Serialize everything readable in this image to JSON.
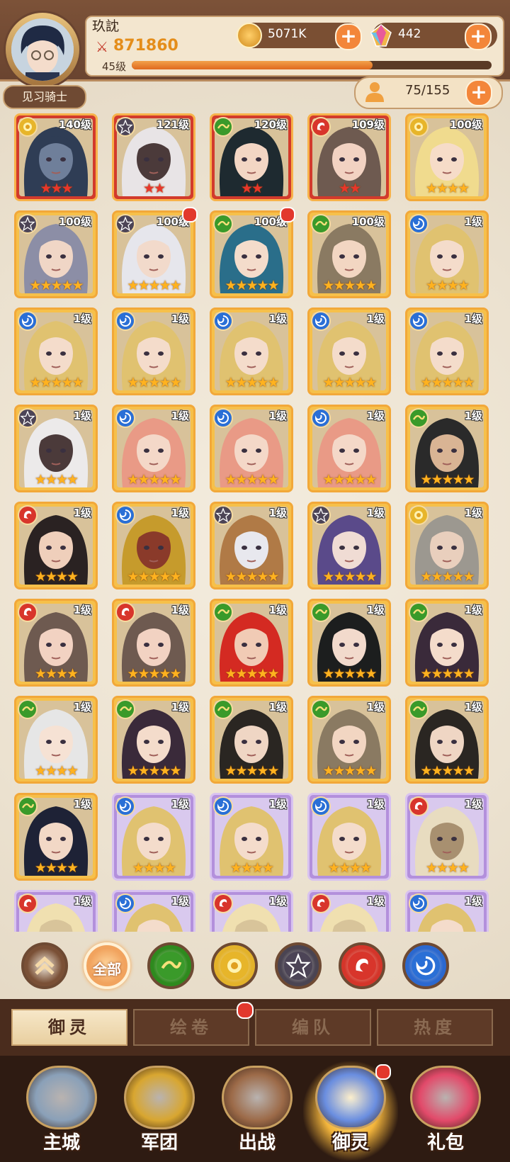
{
  "player": {
    "name": "玖訦",
    "power": "871860",
    "level_label": "45级",
    "level_progress": 0.67,
    "rank_title": "见习骑士"
  },
  "resources": {
    "coins": "5071K",
    "gems": "442",
    "hero_count": "75/155"
  },
  "plus_label": "+",
  "element_colors": {
    "gold": "#e7b52a",
    "dark": "#4c4456",
    "green": "#3a9a2a",
    "red": "#d8352b",
    "blue": "#2a6fd6"
  },
  "heroes": [
    {
      "level": "140级",
      "element": "gold",
      "stars": 3,
      "frame": "red",
      "hair": "#2f3d55",
      "skin": "#6f7f9a"
    },
    {
      "level": "121级",
      "element": "dark",
      "stars": 2,
      "frame": "red",
      "hair": "#e8e4e6",
      "skin": "#4b3a3a"
    },
    {
      "level": "120级",
      "element": "green",
      "stars": 2,
      "frame": "red",
      "hair": "#1e2a30",
      "skin": "#f3d6c4"
    },
    {
      "level": "109级",
      "element": "red",
      "stars": 2,
      "frame": "red",
      "hair": "#6e5a50",
      "skin": "#f2d2c2"
    },
    {
      "level": "100级",
      "element": "gold",
      "stars": 4,
      "frame": "gold",
      "hair": "#f0db8e",
      "skin": "#f6dcc8"
    },
    {
      "level": "100级",
      "element": "dark",
      "stars": 5,
      "frame": "gold",
      "hair": "#8c8ea6",
      "skin": "#f0d6c6"
    },
    {
      "level": "100级",
      "element": "dark",
      "stars": 5,
      "frame": "gold",
      "hair": "#e6e6ec",
      "skin": "#f2dacb",
      "dot": true
    },
    {
      "level": "100级",
      "element": "green",
      "stars": 5,
      "frame": "gold",
      "hair": "#2a6e8a",
      "skin": "#f4dccb",
      "dot": true
    },
    {
      "level": "100级",
      "element": "green",
      "stars": 5,
      "frame": "gold",
      "hair": "#8a7a62",
      "skin": "#f2d6c2"
    },
    {
      "level": "1级",
      "element": "blue",
      "stars": 4,
      "frame": "gold",
      "hair": "#e0c270",
      "skin": "#f4dccb"
    },
    {
      "level": "1级",
      "element": "blue",
      "stars": 5,
      "frame": "gold",
      "hair": "#e0c270",
      "skin": "#f4dccb"
    },
    {
      "level": "1级",
      "element": "blue",
      "stars": 5,
      "frame": "gold",
      "hair": "#e0c270",
      "skin": "#f4dccb"
    },
    {
      "level": "1级",
      "element": "blue",
      "stars": 5,
      "frame": "gold",
      "hair": "#e0c270",
      "skin": "#f4dccb"
    },
    {
      "level": "1级",
      "element": "blue",
      "stars": 5,
      "frame": "gold",
      "hair": "#e0c270",
      "skin": "#f4dccb"
    },
    {
      "level": "1级",
      "element": "blue",
      "stars": 5,
      "frame": "gold",
      "hair": "#e0c270",
      "skin": "#f4dccb"
    },
    {
      "level": "1级",
      "element": "dark",
      "stars": 4,
      "frame": "gold",
      "hair": "#eceaea",
      "skin": "#4b3a3a"
    },
    {
      "level": "1级",
      "element": "blue",
      "stars": 5,
      "frame": "gold",
      "hair": "#e99a86",
      "skin": "#f4d8c8"
    },
    {
      "level": "1级",
      "element": "blue",
      "stars": 5,
      "frame": "gold",
      "hair": "#e99a86",
      "skin": "#f4d8c8"
    },
    {
      "level": "1级",
      "element": "blue",
      "stars": 5,
      "frame": "gold",
      "hair": "#e99a86",
      "skin": "#f4d8c8"
    },
    {
      "level": "1级",
      "element": "green",
      "stars": 5,
      "frame": "gold",
      "hair": "#2a2a2a",
      "skin": "#d9b494"
    },
    {
      "level": "1级",
      "element": "red",
      "stars": 4,
      "frame": "gold",
      "hair": "#2a2222",
      "skin": "#efcfbb"
    },
    {
      "level": "1级",
      "element": "blue",
      "stars": 5,
      "frame": "gold",
      "hair": "#c69b2c",
      "skin": "#8a3a2a"
    },
    {
      "level": "1级",
      "element": "dark",
      "stars": 5,
      "frame": "gold",
      "hair": "#b07a46",
      "skin": "#e8e8ee"
    },
    {
      "level": "1级",
      "element": "dark",
      "stars": 5,
      "frame": "gold",
      "hair": "#5a4a8a",
      "skin": "#f0dcd4"
    },
    {
      "level": "1级",
      "element": "gold",
      "stars": 5,
      "frame": "gold",
      "hair": "#9c9890",
      "skin": "#e9cfbd"
    },
    {
      "level": "1级",
      "element": "red",
      "stars": 4,
      "frame": "gold",
      "hair": "#6e5a50",
      "skin": "#f2d2c2"
    },
    {
      "level": "1级",
      "element": "red",
      "stars": 5,
      "frame": "gold",
      "hair": "#6e5a50",
      "skin": "#f2d2c2"
    },
    {
      "level": "1级",
      "element": "green",
      "stars": 5,
      "frame": "gold",
      "hair": "#d42a22",
      "skin": "#f1cbb5"
    },
    {
      "level": "1级",
      "element": "green",
      "stars": 5,
      "frame": "gold",
      "hair": "#1c1e1e",
      "skin": "#f2dacc"
    },
    {
      "level": "1级",
      "element": "green",
      "stars": 5,
      "frame": "gold",
      "hair": "#3a2a3a",
      "skin": "#f4dccb"
    },
    {
      "level": "1级",
      "element": "green",
      "stars": 4,
      "frame": "gold",
      "hair": "#e6e6e6",
      "skin": "#f6e2d4"
    },
    {
      "level": "1级",
      "element": "green",
      "stars": 5,
      "frame": "gold",
      "hair": "#3a2a3a",
      "skin": "#f4dccb"
    },
    {
      "level": "1级",
      "element": "green",
      "stars": 5,
      "frame": "gold",
      "hair": "#2a2622",
      "skin": "#efd6c4"
    },
    {
      "level": "1级",
      "element": "green",
      "stars": 5,
      "frame": "gold",
      "hair": "#8a7a62",
      "skin": "#f2d6c2"
    },
    {
      "level": "1级",
      "element": "green",
      "stars": 5,
      "frame": "gold",
      "hair": "#2a2622",
      "skin": "#efd6c4"
    },
    {
      "level": "1级",
      "element": "green",
      "stars": 4,
      "frame": "gold",
      "hair": "#1e2236",
      "skin": "#f2d8c6"
    },
    {
      "level": "1级",
      "element": "blue",
      "stars": 4,
      "frame": "purple",
      "hair": "#e0c270",
      "skin": "#f4dccb"
    },
    {
      "level": "1级",
      "element": "blue",
      "stars": 4,
      "frame": "purple",
      "hair": "#e0c270",
      "skin": "#f4dccb"
    },
    {
      "level": "1级",
      "element": "blue",
      "stars": 4,
      "frame": "purple",
      "hair": "#e0c270",
      "skin": "#f4dccb"
    },
    {
      "level": "1级",
      "element": "red",
      "stars": 4,
      "frame": "purple",
      "hair": "#e8dcc0",
      "skin": "#a89070"
    },
    {
      "level": "1级",
      "element": "red",
      "stars": 0,
      "frame": "purple",
      "hair": "#f0e0b0",
      "skin": "#d8c49a"
    },
    {
      "level": "1级",
      "element": "blue",
      "stars": 0,
      "frame": "purple",
      "hair": "#e0c270",
      "skin": "#f4dccb"
    },
    {
      "level": "1级",
      "element": "red",
      "stars": 0,
      "frame": "purple",
      "hair": "#f0e0b0",
      "skin": "#d8c49a"
    },
    {
      "level": "1级",
      "element": "red",
      "stars": 0,
      "frame": "purple",
      "hair": "#f0e0b0",
      "skin": "#d8c49a"
    },
    {
      "level": "1级",
      "element": "blue",
      "stars": 0,
      "frame": "purple",
      "hair": "#e0c270",
      "skin": "#f4dccb"
    }
  ],
  "filters": [
    {
      "name": "collapse",
      "label": "",
      "color": "#7a5036"
    },
    {
      "name": "all",
      "label": "全部",
      "color": "#f1a35e"
    },
    {
      "name": "green",
      "label": "",
      "color": "#2e8a1e"
    },
    {
      "name": "gold",
      "label": "",
      "color": "#e3b22a"
    },
    {
      "name": "dark",
      "label": "",
      "color": "#4a4452"
    },
    {
      "name": "red",
      "label": "",
      "color": "#d4352a"
    },
    {
      "name": "blue",
      "label": "",
      "color": "#2b68cf"
    }
  ],
  "tabs": [
    {
      "label": "御灵",
      "active": true
    },
    {
      "label": "绘卷",
      "active": false,
      "dot": true
    },
    {
      "label": "编队",
      "active": false
    },
    {
      "label": "热度",
      "active": false
    }
  ],
  "nav": [
    {
      "label": "主城",
      "color": "#8aa0b8"
    },
    {
      "label": "军团",
      "color": "#d8a630"
    },
    {
      "label": "出战",
      "color": "#9c6a48"
    },
    {
      "label": "御灵",
      "color": "#6a8ee0",
      "active": true,
      "dot": true
    },
    {
      "label": "礼包",
      "color": "#e24a6a"
    }
  ]
}
